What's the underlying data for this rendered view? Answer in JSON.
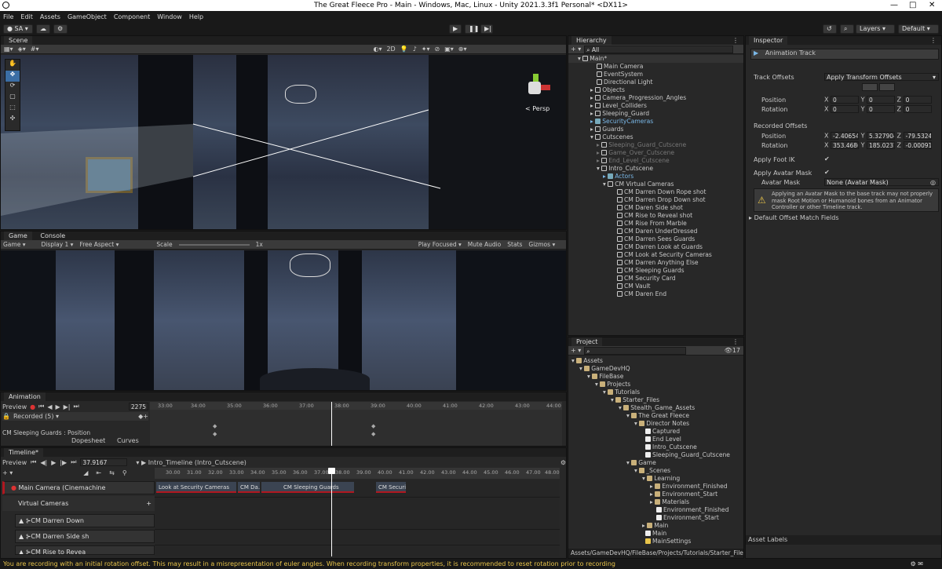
{
  "window": {
    "title": "The Great Fleece Pro - Main - Windows, Mac, Linux - Unity 2021.3.3f1 Personal* <DX11>"
  },
  "menu": [
    "File",
    "Edit",
    "Assets",
    "GameObject",
    "Component",
    "Window",
    "Help"
  ],
  "toolbar": {
    "account": "SA",
    "layers": "Layers",
    "layout": "Default"
  },
  "scene": {
    "tab": "Scene",
    "mode_2d": "2D",
    "persp_label": "< Persp"
  },
  "game": {
    "tab": "Game",
    "console_tab": "Console",
    "display_dropdown": "Game",
    "display": "Display 1",
    "aspect": "Free Aspect",
    "scale_label": "Scale",
    "scale_value": "1x",
    "play_focused": "Play Focused",
    "mute": "Mute Audio",
    "stats": "Stats",
    "gizmos": "Gizmos"
  },
  "animation": {
    "tab": "Animation",
    "preview": "Preview",
    "frame": "2275",
    "recorded": "Recorded (5)",
    "property": "CM Sleeping Guards : Position",
    "dopesheet": "Dopesheet",
    "curves": "Curves",
    "ticks": [
      "33:00",
      "34:00",
      "35:00",
      "36:00",
      "37:00",
      "38:00",
      "39:00",
      "40:00",
      "41:00",
      "42:00",
      "43:00",
      "44:00"
    ]
  },
  "timeline": {
    "tab": "Timeline*",
    "preview": "Preview",
    "time": "37.9167",
    "asset": "Intro_Timeline (Intro_Cutscene)",
    "ticks": [
      "30.00",
      "31.00",
      "32.00",
      "33.00",
      "34.00",
      "35.00",
      "36.00",
      "37.00",
      "38.00",
      "39.00",
      "40.00",
      "41.00",
      "42.00",
      "43.00",
      "44.00",
      "45.00",
      "46.00",
      "47.00",
      "48.00"
    ],
    "tracks": {
      "main_camera": "Main Camera (Cinemachine",
      "group": "Virtual Cameras",
      "t1": "CM Darren Down",
      "t2": "CM Darren Side sh",
      "t3": "CM Rise to Revea"
    },
    "clips": [
      "Look at Security Cameras",
      "CM Da...",
      "CM Sleeping Guards",
      "CM Securi..."
    ]
  },
  "hierarchy": {
    "tab": "Hierarchy",
    "search_placeholder": "All",
    "items": [
      "Main*",
      "Main Camera",
      "EventSystem",
      "Directional Light",
      "Objects",
      "Camera_Progression_Angles",
      "Level_Colliders",
      "Sleeping_Guard",
      "SecurityCameras",
      "Guards",
      "Cutscenes",
      "Sleeping_Guard_Cutscene",
      "Game_Over_Cutscene",
      "End_Level_Cutscene",
      "Intro_Cutscene",
      "Actors",
      "CM Virtual Cameras",
      "CM Darren Down Rope shot",
      "CM Darren Drop Down shot",
      "CM Daren Side shot",
      "CM Rise to Reveal shot",
      "CM Rise From Marble",
      "CM Daren UnderDressed",
      "CM Darren Sees Guards",
      "CM Darren Look at Guards",
      "CM Look at Security Cameras",
      "CM Darren Anything Else",
      "CM Sleeping Guards",
      "CM Security Card",
      "CM Vault",
      "CM Daren End"
    ]
  },
  "project": {
    "tab": "Project",
    "count": "17",
    "items": [
      "Assets",
      "GameDevHQ",
      "FileBase",
      "Projects",
      "Tutorials",
      "Starter_Files",
      "Stealth_Game_Assets",
      "The Great Fleece",
      "Director Notes",
      "Captured",
      "End Level",
      "Intro_Cutscene",
      "Sleeping_Guard_Cutscene",
      "Game",
      "_Scenes",
      "Learning",
      "Environment_Finished",
      "Environment_Start",
      "Materials",
      "Environment_Finished",
      "Environment_Start",
      "Main",
      "Main",
      "MainSettings"
    ],
    "path": "Assets/GameDevHQ/FileBase/Projects/Tutorials/Starter_File"
  },
  "inspector": {
    "tab": "Inspector",
    "component": "Animation Track",
    "track_offsets_label": "Track Offsets",
    "track_offsets_value": "Apply Transform Offsets",
    "position_label": "Position",
    "rotation_label": "Rotation",
    "offset_pos": [
      "0",
      "0",
      "0"
    ],
    "offset_rot": [
      "0",
      "0",
      "0"
    ],
    "recorded_offsets": "Recorded Offsets",
    "rec_pos": [
      "-2.40654",
      "5.327904",
      "-79.5324"
    ],
    "rec_rot": [
      "353.4686",
      "185.0237",
      "-0.00091"
    ],
    "apply_foot_ik": "Apply Foot IK",
    "apply_avatar_mask": "Apply Avatar Mask",
    "avatar_mask_label": "Avatar Mask",
    "avatar_mask_value": "None (Avatar Mask)",
    "warning": "Applying an Avatar Mask to the base track may not properly mask Root Motion or Humanoid bones from an Animator Controller or other Timeline track.",
    "default_offset": "Default Offset Match Fields",
    "asset_labels": "Asset Labels"
  },
  "status": {
    "message": "You are recording with an initial rotation offset. This may result in a misrepresentation of euler angles. When recording transform properties, it is recommended to reset rotation prior to recording"
  }
}
